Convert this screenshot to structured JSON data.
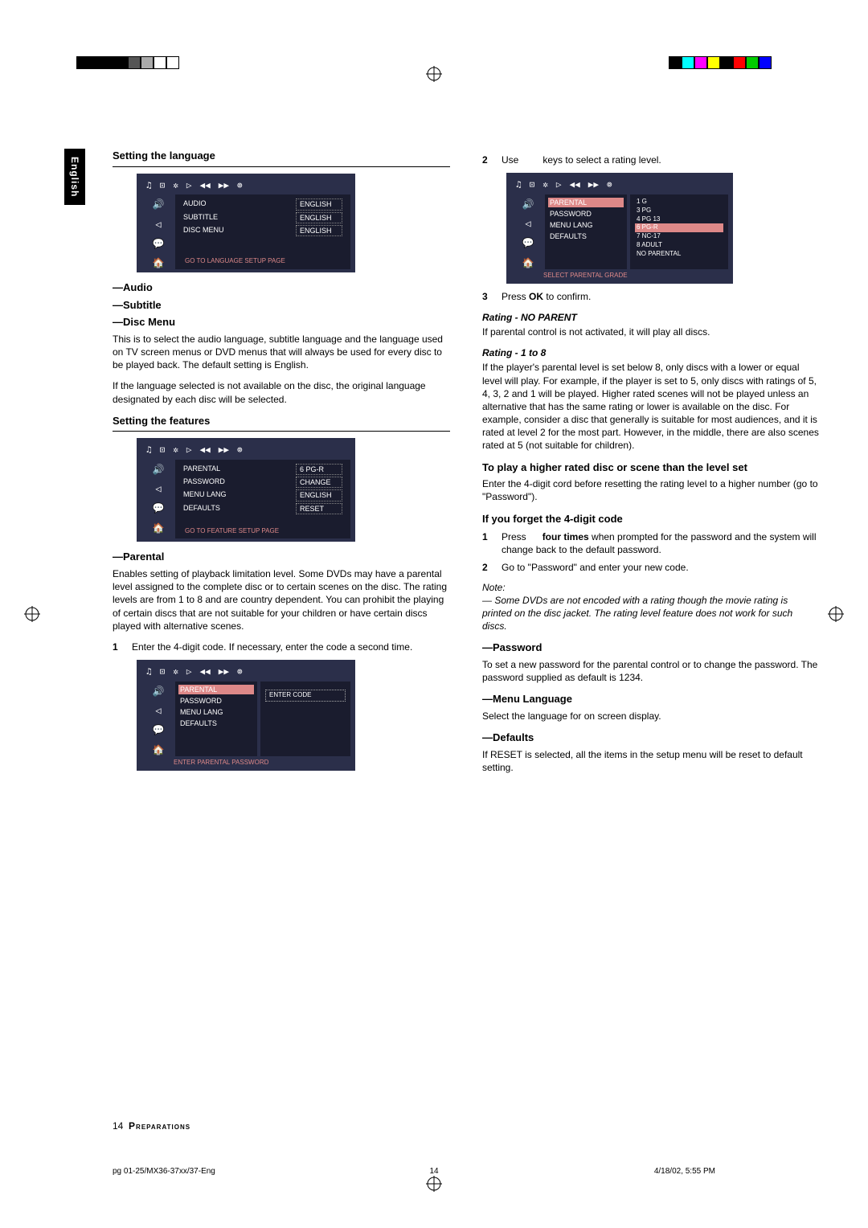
{
  "lang_tab": "English",
  "left": {
    "h_lang": "Setting the language",
    "osd_lang": {
      "top_icons": [
        "♫",
        "⊡",
        "✲",
        "▷",
        "◀◀",
        "▶▶",
        "⊚"
      ],
      "left_icons": [
        "🔊",
        "◁",
        "💬",
        "🏠"
      ],
      "items": [
        {
          "lab": "AUDIO",
          "val": "ENGLISH"
        },
        {
          "lab": "SUBTITLE",
          "val": "ENGLISH"
        },
        {
          "lab": "DISC MENU",
          "val": "ENGLISH"
        }
      ],
      "foot": "GO TO LANGUAGE SETUP PAGE"
    },
    "h_audio": "—Audio",
    "h_subtitle": "—Subtitle",
    "h_discmenu": "—Disc Menu",
    "p_lang1": "This is to select the audio language, subtitle language and the language used on TV screen menus or DVD menus that will always be used for every disc to be played back. The default setting is English.",
    "p_lang2": "If the language selected is not available on the disc, the original language designated by each disc will be selected.",
    "h_features": "Setting the features",
    "osd_feat": {
      "items": [
        {
          "lab": "PARENTAL",
          "val": "6 PG-R"
        },
        {
          "lab": "PASSWORD",
          "val": "CHANGE"
        },
        {
          "lab": "MENU LANG",
          "val": "ENGLISH"
        },
        {
          "lab": "DEFAULTS",
          "val": "RESET"
        }
      ],
      "foot": "GO TO FEATURE SETUP PAGE"
    },
    "h_parental": "—Parental",
    "p_parental": "Enables setting of playback limitation level. Some DVDs may have a parental level assigned to the complete disc or to certain scenes on the disc. The rating levels are from 1 to 8 and are country dependent. You can prohibit the playing of certain discs that are not suitable for your children or have certain discs played with alternative scenes.",
    "step1_n": "1",
    "step1_t": "Enter the 4-digit code. If necessary, enter the code a second time.",
    "osd_pass": {
      "items": [
        {
          "lab": "PARENTAL",
          "sel": true
        },
        {
          "lab": "PASSWORD"
        },
        {
          "lab": "MENU LANG"
        },
        {
          "lab": "DEFAULTS"
        }
      ],
      "entry": "ENTER CODE",
      "foot": "ENTER PARENTAL PASSWORD"
    }
  },
  "right": {
    "step2_n": "2",
    "step2_pre": "Use",
    "step2_post": "keys to select a rating level.",
    "osd_rating": {
      "items": [
        "PARENTAL",
        "PASSWORD",
        "MENU LANG",
        "DEFAULTS"
      ],
      "ratings": [
        "1 G",
        "3 PG",
        "4 PG 13",
        "6 PG-R",
        "7 NC-17",
        "8 ADULT",
        "NO PARENTAL"
      ],
      "sel_rating": "6 PG-R",
      "foot": "SELECT PARENTAL GRADE"
    },
    "step3_n": "3",
    "step3_t_pre": "Press ",
    "step3_t_bold": "OK",
    "step3_t_post": " to confirm.",
    "h_noparent": "Rating - NO PARENT",
    "p_noparent": "If parental control is not activated, it will play all discs.",
    "h_rating18": "Rating - 1 to 8",
    "p_rating18": "If the player's parental level is set below 8, only discs with a lower or equal level will play. For example, if the player is set to 5, only discs with ratings of 5, 4, 3, 2 and 1 will be played. Higher rated scenes will not be played unless an alternative that has the same rating or lower is available on the disc. For example, consider a disc that generally is suitable for most audiences, and it is rated at level 2 for the most part. However, in the middle, there are also scenes rated at 5 (not suitable for children).",
    "h_higher": "To play a higher rated disc or scene than the level set",
    "p_higher": "Enter the 4-digit cord before resetting the rating level to a higher number (go to \"Password\").",
    "h_forget": "If you forget the 4-digit code",
    "forget1_n": "1",
    "forget1_pre": "Press ",
    "forget1_bold": "four times",
    "forget1_post": " when prompted for the password and the system will change back to the default password.",
    "forget2_n": "2",
    "forget2_t": "Go to \"Password\" and enter your new code.",
    "note_label": "Note:",
    "note_text": "— Some DVDs are not encoded with a rating though the movie rating is printed on the disc jacket. The rating level feature does not work for such discs.",
    "h_password": "—Password",
    "p_password": "To set a new password for the parental control or to change the password. The password supplied as default is 1234.",
    "h_menulang": "—Menu Language",
    "p_menulang": "Select the language for on screen display.",
    "h_defaults": "—Defaults",
    "p_defaults": "If RESET is selected, all the items in the setup menu will be reset to default setting."
  },
  "footer": {
    "page": "14",
    "section": "Preparations"
  },
  "printline": {
    "left": "pg 01-25/MX36-37xx/37-Eng",
    "mid": "14",
    "right": "4/18/02, 5:55 PM"
  }
}
